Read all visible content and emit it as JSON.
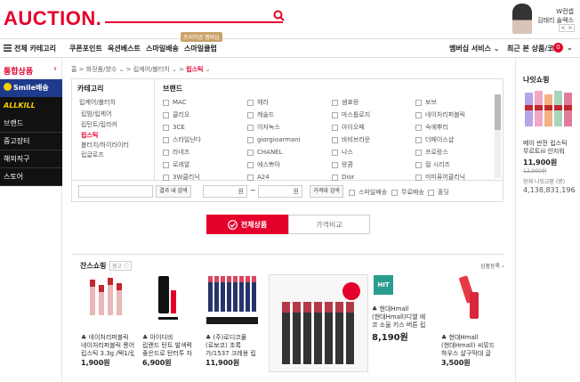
{
  "header": {
    "logo": "AUCTION.",
    "banner_line1": "W컨셉",
    "banner_line2": "김태리 솔렉스",
    "banner_prev": "<",
    "banner_next": ">"
  },
  "gnb": {
    "all_category": "전체 카테고리",
    "items": [
      "쿠폰포인트",
      "옥션베스트",
      "스마일배송",
      "스마일클럽"
    ],
    "new_badge": "프리미엄 멤버십",
    "membership": "멤버십 서비스",
    "recent": "최근 본 상품/코너",
    "recent_count": "0"
  },
  "sidebar": {
    "title": "통합상품",
    "smile": "Smile배송",
    "allkill": "ALLKILL",
    "menus": [
      "브랜드",
      "중고장터",
      "해외직구",
      "스토어"
    ]
  },
  "breadcrumb": {
    "home": "홈",
    "c1": "화장품/향수",
    "c2": "립케어/볼터치",
    "c3": "립스틱"
  },
  "category": {
    "head": "카테고리",
    "items": [
      "립케어/볼터치",
      "립밤/립케어",
      "립틴트/립라커",
      "립스틱",
      "볼터치/하이라이터",
      "립글로즈"
    ],
    "active_index": 3
  },
  "brands": {
    "head": "브랜드",
    "col1": [
      "MAC",
      "클리오",
      "3CE",
      "스타일난다",
      "라네즈",
      "로레알",
      "3W클리닉"
    ],
    "col2": [
      "헤라",
      "캐슬드",
      "이자녹스",
      "giorgioarmani",
      "CHANEL",
      "에스쁘아",
      "A24"
    ],
    "col3": [
      "샘표랑",
      "마스틀로지",
      "아이오페",
      "바비브라운",
      "나스",
      "랑콤",
      "Dior"
    ],
    "col4": [
      "보브",
      "네이처리퍼블릭",
      "숙에뿌리",
      "더페이스샵",
      "프로랑스",
      "컬 시리즈",
      "미미퓨어클리닉"
    ]
  },
  "filters": {
    "keyword_placeholder": "",
    "search_in_result": "결과 내 검색",
    "price_unit1": "원",
    "price_tilde": "~",
    "price_unit2": "원",
    "price_search": "가격대 검색",
    "opt1": "스마일배송",
    "opt2": "무료배송",
    "opt3": "홀딩"
  },
  "tabs": {
    "all": "전체상품",
    "compare": "가격비교"
  },
  "store_section": {
    "title": "잔스쇼핑",
    "ad": "광고",
    "more": "상품등록 ›"
  },
  "products": [
    {
      "seller": "네이처리퍼블릭",
      "name1": "네이처리퍼블릭 롱어",
      "name2": "립스틱 3.3g /택1/립",
      "price": "1,900원"
    },
    {
      "seller": "아이디비",
      "name1": "립랜드 탄트 발색력",
      "name2": "좋은드로 탄터투 자",
      "price": "6,900원"
    },
    {
      "seller": "(주)로디코몰",
      "name1": "(로보코) 초록",
      "name2": "가/1537 크레용 립",
      "price": "11,900원"
    },
    {
      "seller": "현대Hmall",
      "name1": "(현대Hmall)디엘 에",
      "name2": "코 소울 키스 버튼 립",
      "price": "8,190원",
      "badge": "HIT"
    },
    {
      "seller": "현대Hmall",
      "name1": "(현대Hmall) 씨뮤드",
      "name2": "하우스 살구막대 글",
      "price": "3,500원"
    }
  ],
  "right_panel": {
    "title": "나잇쇼핑",
    "desc1": "메이 반전 립스틱",
    "desc2": "무르트iii 안지워",
    "price": "11,900원",
    "old_price": "12,900원",
    "points_label": "현재 나잇교환 (명)",
    "points": "4,138,831,196"
  }
}
